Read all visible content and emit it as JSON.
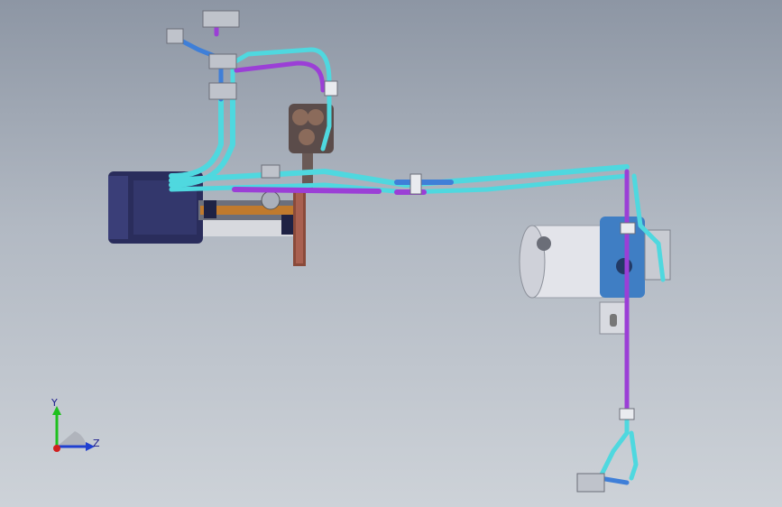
{
  "viewport": {
    "background_top": "#8d96a4",
    "background_bottom": "#cdd2d8"
  },
  "model": {
    "pipe_cyan": "#4fd8df",
    "pipe_purple": "#9b3fd6",
    "pipe_blue": "#3f7fd8",
    "motor_dark": "#2a2d5c",
    "pump_white": "#e3e4ea",
    "bracket_blue": "#3f7ec4",
    "flange_brown": "#8a4a3a"
  },
  "triad": {
    "y_label": "Y",
    "z_label": "Z",
    "y_color": "#1ec01e",
    "z_color": "#1f3fd0",
    "x_color": "#d01f1f"
  }
}
